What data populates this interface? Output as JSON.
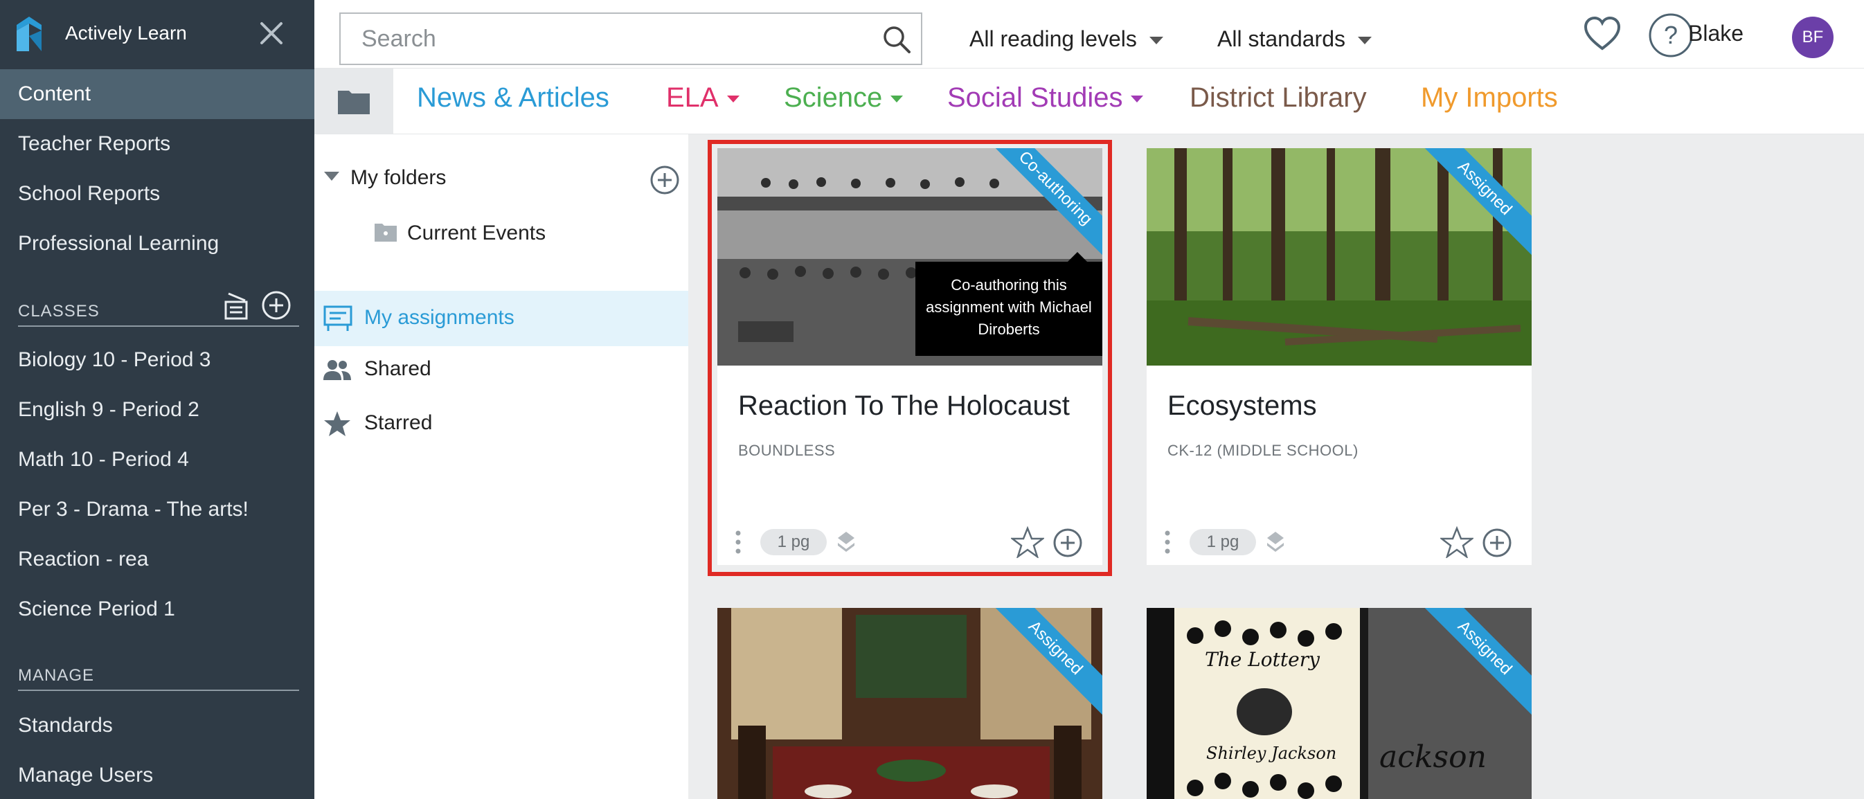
{
  "app": {
    "name": "Actively Learn",
    "logo_icon": "actively-learn-logo",
    "close_icon": "close-icon"
  },
  "sidebar": {
    "primary": [
      {
        "label": "Content",
        "active": true
      },
      {
        "label": "Teacher Reports"
      },
      {
        "label": "School Reports"
      },
      {
        "label": "Professional Learning"
      }
    ],
    "classes_heading": "CLASSES",
    "classes": [
      {
        "label": "Biology 10 - Period 3"
      },
      {
        "label": "English 9 - Period 2"
      },
      {
        "label": "Math 10 - Period 4"
      },
      {
        "label": "Per 3 - Drama - The arts!"
      },
      {
        "label": "Reaction - rea"
      },
      {
        "label": "Science Period 1"
      }
    ],
    "manage_heading": "MANAGE",
    "manage": [
      {
        "label": "Standards"
      },
      {
        "label": "Manage Users"
      }
    ]
  },
  "topbar": {
    "search_placeholder": "Search",
    "reading_levels": "All reading levels",
    "standards": "All standards",
    "user_name": "Blake",
    "avatar_initials": "BF"
  },
  "tabs": [
    {
      "label": "News & Articles",
      "color": "#2a9bd6",
      "dropdown": false
    },
    {
      "label": "ELA",
      "color": "#e0306a",
      "dropdown": true
    },
    {
      "label": "Science",
      "color": "#4caf50",
      "dropdown": true
    },
    {
      "label": "Social Studies",
      "color": "#a23bb5",
      "dropdown": true
    },
    {
      "label": "District Library",
      "color": "#7a5a4a",
      "dropdown": false
    },
    {
      "label": "My Imports",
      "color": "#f09a2c",
      "dropdown": false
    }
  ],
  "folders": {
    "my_folders": "My folders",
    "current_events": "Current Events",
    "my_assignments": "My assignments",
    "shared": "Shared",
    "starred": "Starred"
  },
  "cards": [
    {
      "title": "Reaction To The Holocaust",
      "source": "BOUNDLESS",
      "pages": "1 pg",
      "ribbon": "Co-authoring"
    },
    {
      "title": "Ecosystems",
      "source": "CK-12 (MIDDLE SCHOOL)",
      "pages": "1 pg",
      "ribbon": "Assigned"
    },
    {
      "ribbon": "Assigned"
    },
    {
      "ribbon": "Assigned",
      "image_title": "The Lottery",
      "image_author": "Shirley Jackson",
      "image_partial": "ackson"
    }
  ],
  "tooltip": "Co-authoring this assignment with Michael Diroberts",
  "colors": {
    "sidebar_bg": "#2f3b46",
    "sidebar_active": "#4e6371",
    "accent_blue": "#2a9bd6",
    "highlight_red": "#e02a24",
    "avatar_purple": "#6b3fa8"
  }
}
